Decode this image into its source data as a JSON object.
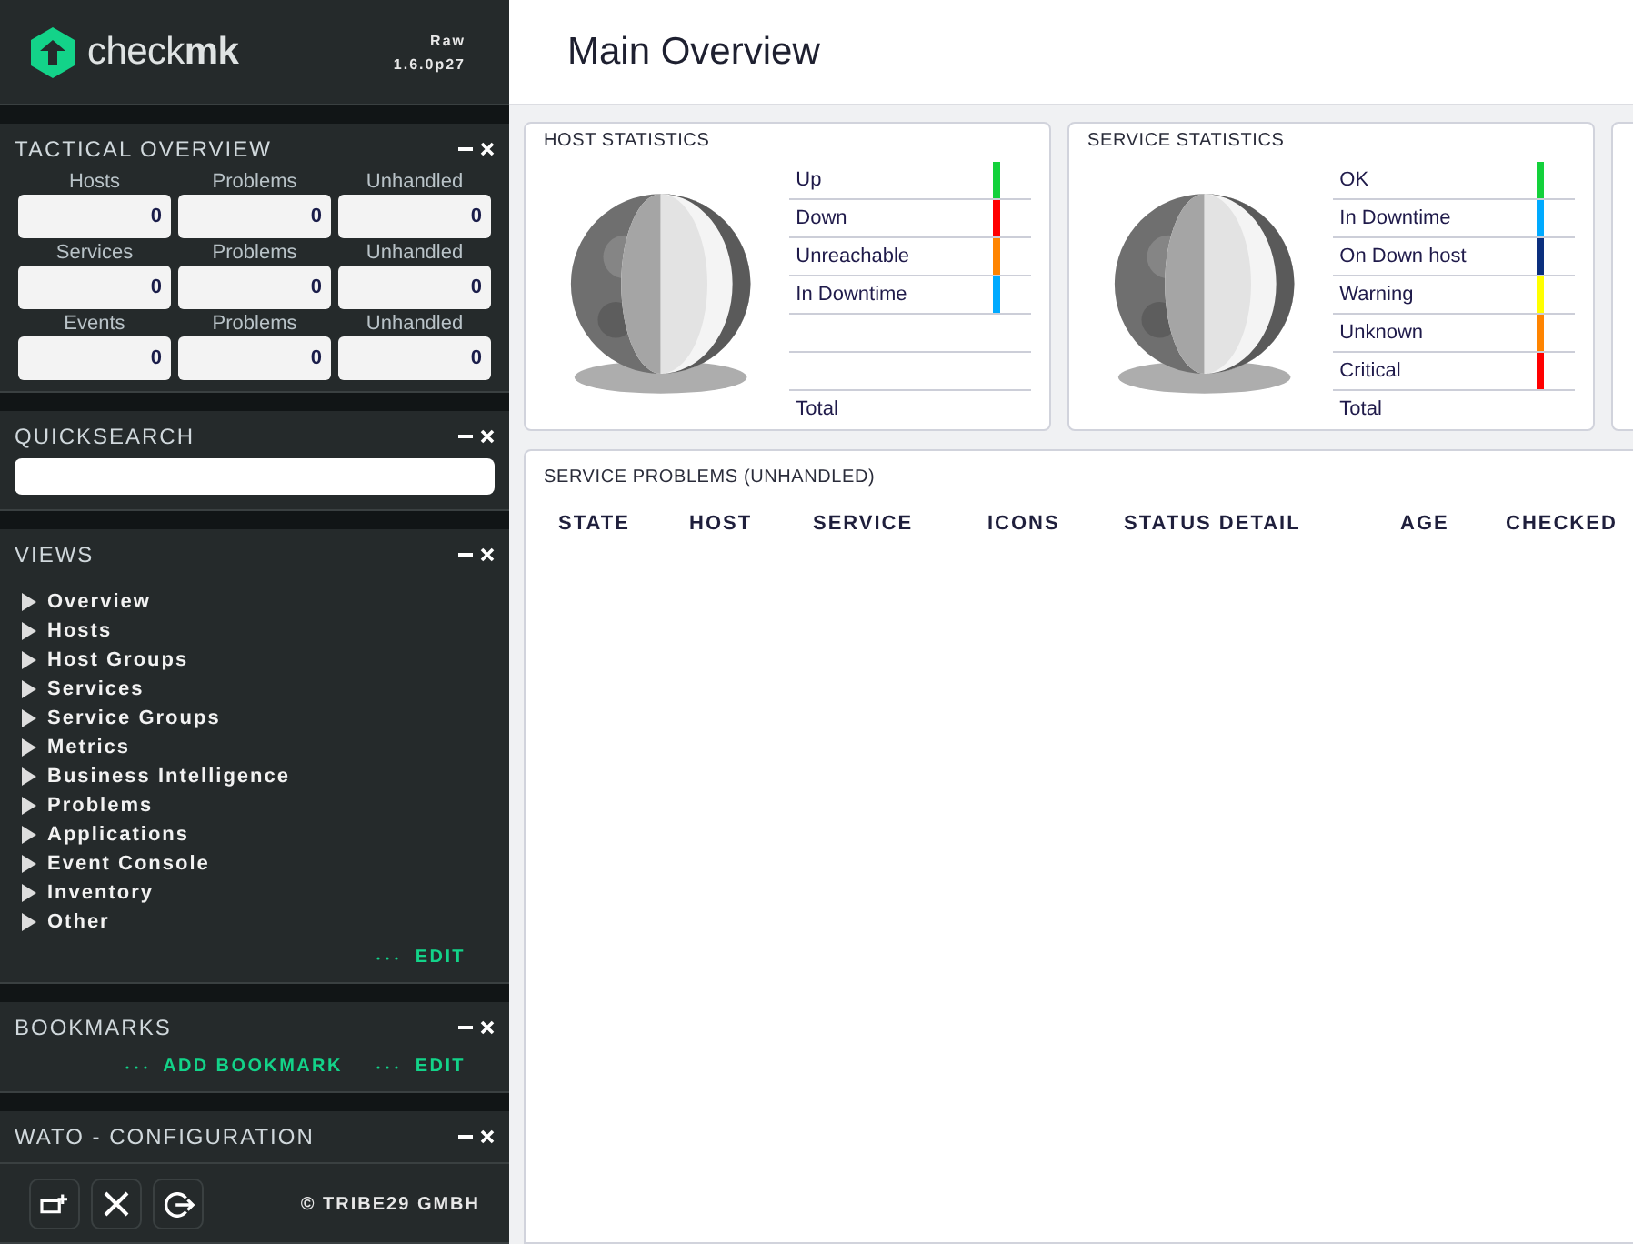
{
  "sidebar": {
    "logo": "check**mk**",
    "edition": "Raw",
    "version": "1.6.0p27",
    "tactical_overview": {
      "title": "TACTICAL OVERVIEW",
      "rows": [
        {
          "cells": [
            {
              "label": "Hosts",
              "value": "0"
            },
            {
              "label": "Problems",
              "value": "0"
            },
            {
              "label": "Unhandled",
              "value": "0"
            }
          ]
        },
        {
          "cells": [
            {
              "label": "Services",
              "value": "0"
            },
            {
              "label": "Problems",
              "value": "0"
            },
            {
              "label": "Unhandled",
              "value": "0"
            }
          ]
        },
        {
          "cells": [
            {
              "label": "Events",
              "value": "0"
            },
            {
              "label": "Problems",
              "value": "0"
            },
            {
              "label": "Unhandled",
              "value": "0"
            }
          ]
        }
      ]
    },
    "quicksearch": {
      "title": "QUICKSEARCH"
    },
    "views": {
      "title": "VIEWS",
      "items": [
        "Overview",
        "Hosts",
        "Host Groups",
        "Services",
        "Service Groups",
        "Metrics",
        "Business Intelligence",
        "Problems",
        "Applications",
        "Event Console",
        "Inventory",
        "Other"
      ],
      "links": [
        "EDIT"
      ]
    },
    "bookmarks": {
      "title": "BOOKMARKS",
      "links": [
        "ADD BOOKMARK",
        "EDIT"
      ]
    },
    "wato": {
      "title": "WATO - CONFIGURATION"
    },
    "footer_buttons": [
      {
        "kind": "add"
      },
      {
        "kind": "tools"
      },
      {
        "kind": "logout"
      }
    ],
    "copyright": "© TRIBE29 GMBH"
  },
  "main": {
    "title": "Main Overview",
    "host_statistics": {
      "title": "HOST STATISTICS",
      "rows": [
        {
          "kind": "item",
          "label": "Up",
          "color": "#13d13b"
        },
        {
          "kind": "item",
          "label": "Down",
          "color": "#ff0000"
        },
        {
          "kind": "item",
          "label": "Unreachable",
          "color": "#ff8400"
        },
        {
          "kind": "item",
          "label": "In Downtime",
          "color": "#00aaff"
        },
        {
          "kind": "spacer"
        },
        {
          "kind": "spacer"
        },
        {
          "kind": "total",
          "label": "Total"
        }
      ]
    },
    "service_statistics": {
      "title": "SERVICE STATISTICS",
      "rows": [
        {
          "kind": "item",
          "label": "OK",
          "color": "#13d13b"
        },
        {
          "kind": "item",
          "label": "In Downtime",
          "color": "#00aaff"
        },
        {
          "kind": "item",
          "label": "On Down host",
          "color": "#0b2f7e"
        },
        {
          "kind": "item",
          "label": "Warning",
          "color": "#ffff00"
        },
        {
          "kind": "item",
          "label": "Unknown",
          "color": "#ff8400"
        },
        {
          "kind": "item",
          "label": "Critical",
          "color": "#ff0000"
        },
        {
          "kind": "total",
          "label": "Total"
        }
      ]
    },
    "service_problems": {
      "title": "SERVICE PROBLEMS (UNHANDLED)",
      "columns": [
        "STATE",
        "HOST",
        "SERVICE",
        "ICONS",
        "STATUS DETAIL",
        "AGE",
        "CHECKED"
      ]
    }
  }
}
